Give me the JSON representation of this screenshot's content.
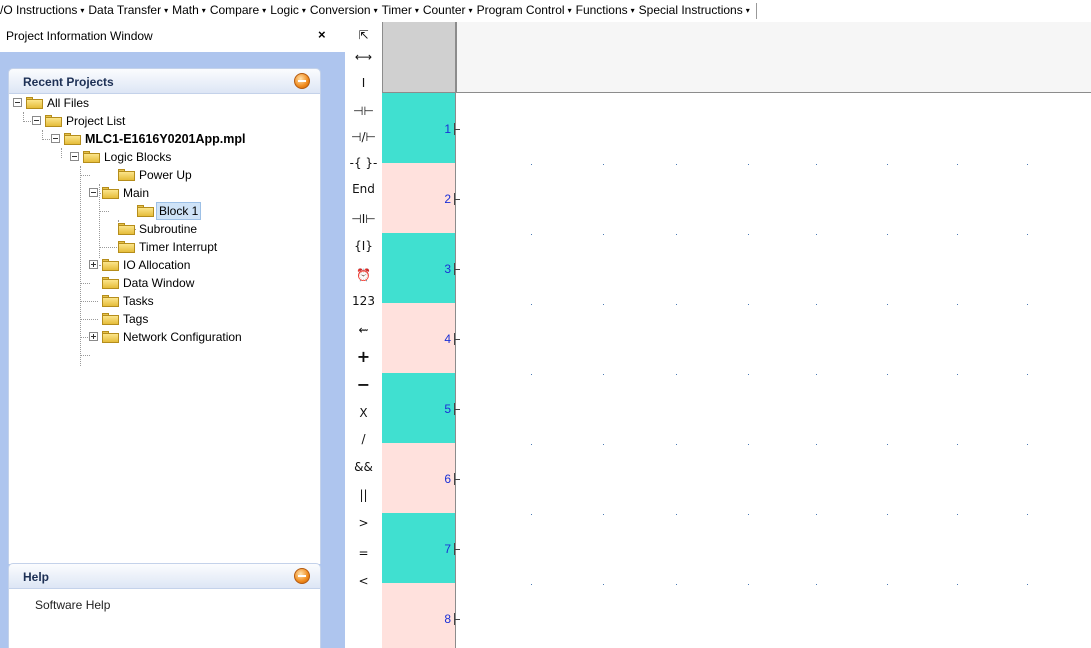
{
  "menubar": {
    "items": [
      "/O Instructions",
      "Data Transfer",
      "Math",
      "Compare",
      "Logic",
      "Conversion",
      "Timer",
      "Counter",
      "Program Control",
      "Functions",
      "Special Instructions"
    ],
    "arrow": "▾"
  },
  "left_panel": {
    "title": "Project Information Window",
    "close_label": "×",
    "recent_projects": {
      "title": "Recent Projects",
      "tree": {
        "all_files": "All Files",
        "project_list": "Project List",
        "project_file": "MLC1-E1616Y0201App.mpl",
        "logic_blocks": "Logic Blocks",
        "power_up": "Power Up",
        "main": "Main",
        "block_1": "Block 1",
        "subroutine": "Subroutine",
        "timer_interrupt": "Timer Interrupt",
        "io_allocation": "IO Allocation",
        "data_window": "Data Window",
        "tasks": "Tasks",
        "tags": "Tags",
        "network_configuration": "Network Configuration"
      }
    },
    "help": {
      "title": "Help",
      "link": "Software Help"
    }
  },
  "toolbar": {
    "tools": [
      {
        "name": "pointer-tool-icon",
        "glyph": "⇱"
      },
      {
        "name": "horizontal-wire-tool-icon",
        "glyph": "⟷"
      },
      {
        "name": "vertical-wire-tool-icon",
        "glyph": "I"
      },
      {
        "name": "no-contact-tool-icon",
        "glyph": "⊣⊢"
      },
      {
        "name": "nc-contact-tool-icon",
        "glyph": "⊣/⊢"
      },
      {
        "name": "coil-tool-icon",
        "glyph": "-{ }-"
      },
      {
        "name": "end-tool",
        "glyph": "End"
      },
      {
        "name": "positive-transition-contact-icon",
        "glyph": "⊣I⊢"
      },
      {
        "name": "special-coil-tool-icon",
        "glyph": "{I}"
      },
      {
        "name": "timer-tool-icon",
        "glyph": "⏰"
      },
      {
        "name": "counter-tool",
        "glyph": "123"
      },
      {
        "name": "move-tool-icon",
        "glyph": "⇜"
      },
      {
        "name": "add-tool",
        "glyph": "+"
      },
      {
        "name": "subtract-tool",
        "glyph": "−"
      },
      {
        "name": "multiply-tool",
        "glyph": "X"
      },
      {
        "name": "divide-tool",
        "glyph": "/"
      },
      {
        "name": "and-tool",
        "glyph": "&&"
      },
      {
        "name": "or-tool",
        "glyph": "||"
      },
      {
        "name": "greater-than-tool",
        "glyph": ">"
      },
      {
        "name": "equal-tool",
        "glyph": "="
      },
      {
        "name": "less-than-tool",
        "glyph": "<"
      }
    ]
  },
  "ladder": {
    "rungs": [
      "1",
      "2",
      "3",
      "4",
      "5",
      "6",
      "7",
      "8"
    ],
    "colors": {
      "odd": "#40e0d0",
      "even": "#ffe1dd"
    }
  }
}
